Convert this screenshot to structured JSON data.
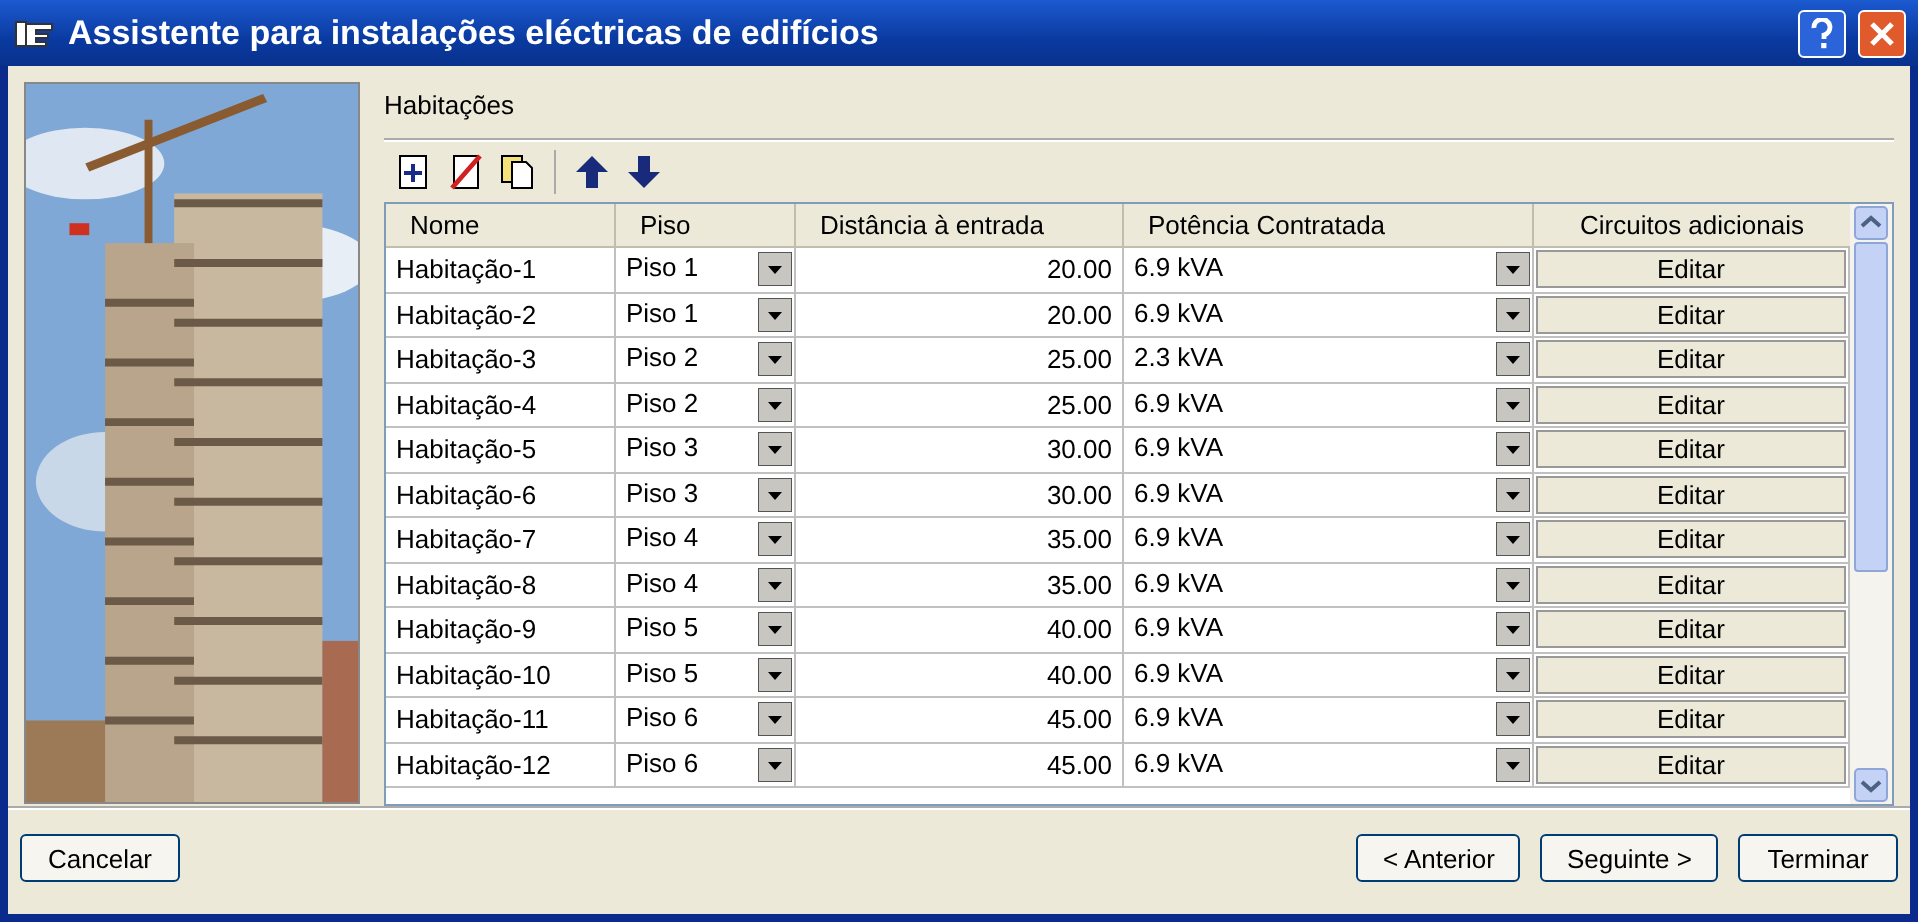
{
  "window": {
    "title": "Assistente para instalações eléctricas de edifícios"
  },
  "section_title": "Habitações",
  "table": {
    "columns": [
      "Nome",
      "Piso",
      "Distância à entrada",
      "Potência Contratada",
      "Circuitos adicionais"
    ],
    "rows": [
      {
        "nome": "Habitação-1",
        "piso": "Piso 1",
        "distancia": "20.00",
        "potencia": "6.9 kVA",
        "action": "Editar"
      },
      {
        "nome": "Habitação-2",
        "piso": "Piso 1",
        "distancia": "20.00",
        "potencia": "6.9 kVA",
        "action": "Editar"
      },
      {
        "nome": "Habitação-3",
        "piso": "Piso 2",
        "distancia": "25.00",
        "potencia": "2.3 kVA",
        "action": "Editar"
      },
      {
        "nome": "Habitação-4",
        "piso": "Piso 2",
        "distancia": "25.00",
        "potencia": "6.9 kVA",
        "action": "Editar"
      },
      {
        "nome": "Habitação-5",
        "piso": "Piso 3",
        "distancia": "30.00",
        "potencia": "6.9 kVA",
        "action": "Editar"
      },
      {
        "nome": "Habitação-6",
        "piso": "Piso 3",
        "distancia": "30.00",
        "potencia": "6.9 kVA",
        "action": "Editar"
      },
      {
        "nome": "Habitação-7",
        "piso": "Piso 4",
        "distancia": "35.00",
        "potencia": "6.9 kVA",
        "action": "Editar"
      },
      {
        "nome": "Habitação-8",
        "piso": "Piso 4",
        "distancia": "35.00",
        "potencia": "6.9 kVA",
        "action": "Editar"
      },
      {
        "nome": "Habitação-9",
        "piso": "Piso 5",
        "distancia": "40.00",
        "potencia": "6.9 kVA",
        "action": "Editar"
      },
      {
        "nome": "Habitação-10",
        "piso": "Piso 5",
        "distancia": "40.00",
        "potencia": "6.9 kVA",
        "action": "Editar"
      },
      {
        "nome": "Habitação-11",
        "piso": "Piso 6",
        "distancia": "45.00",
        "potencia": "6.9 kVA",
        "action": "Editar"
      },
      {
        "nome": "Habitação-12",
        "piso": "Piso 6",
        "distancia": "45.00",
        "potencia": "6.9 kVA",
        "action": "Editar"
      }
    ]
  },
  "buttons_left": [
    "Cancelar"
  ],
  "buttons_right": [
    "< Anterior",
    "Seguinte >",
    "Terminar"
  ]
}
